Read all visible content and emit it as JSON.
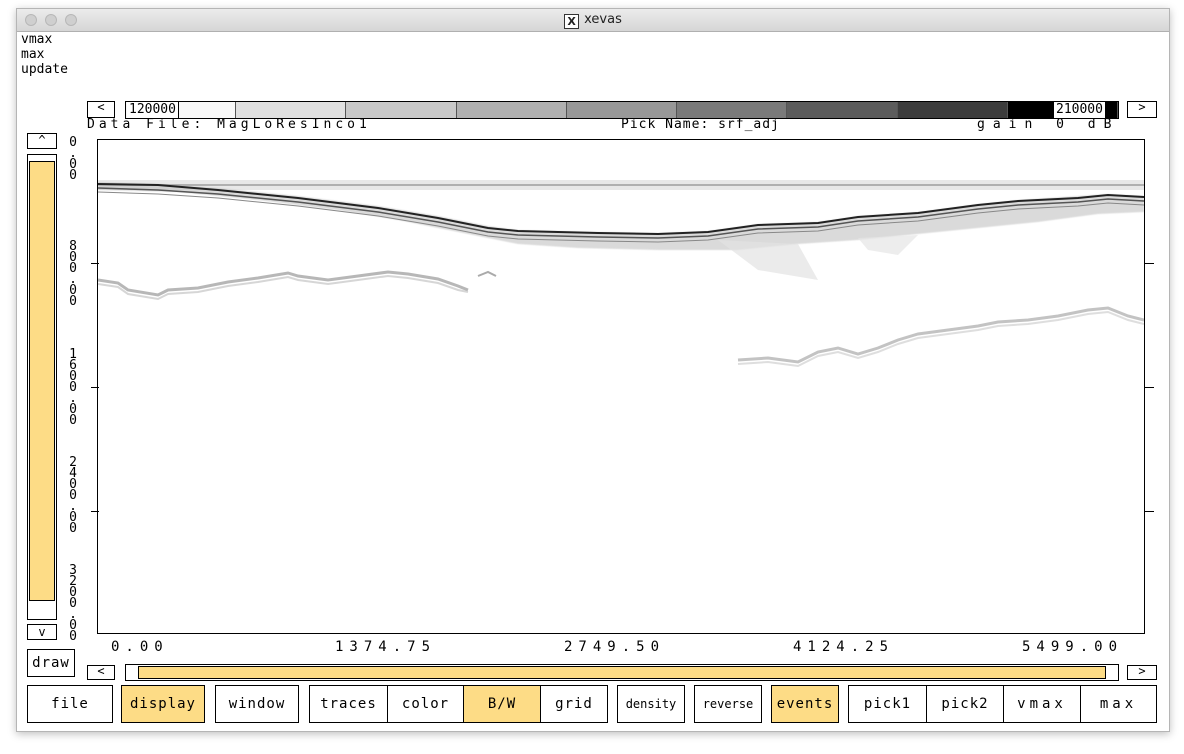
{
  "window": {
    "title": "xevas",
    "title_glyph": "X"
  },
  "messages": [
    "vmax",
    "max",
    "update"
  ],
  "colorbar": {
    "min_label": "120000",
    "max_label": "210000",
    "left_arrow": "<",
    "right_arrow": ">",
    "steps": [
      "#f8f8f8",
      "#e0e0e0",
      "#c8c8c8",
      "#b0b0b0",
      "#989898",
      "#7a7a7a",
      "#5c5c5c",
      "#3c3c3c",
      "#000000"
    ]
  },
  "header": {
    "data_file": "Data File: MagLoResInco1",
    "pick_name": "Pick Name: srf_adj",
    "gain": "gain 0 dB"
  },
  "vscroll": {
    "up": "^",
    "down": "v",
    "draw": "draw",
    "level": 0.96
  },
  "y_axis": {
    "labels": [
      {
        "chars": "0.00"
      },
      {
        "chars": "800.00"
      },
      {
        "chars": "1600.00"
      },
      {
        "chars": "2400.00"
      },
      {
        "chars": "3200.00"
      }
    ]
  },
  "x_axis": {
    "labels": [
      "0.00",
      "1374.75",
      "2749.50",
      "4124.25",
      "5499.00"
    ]
  },
  "hscroll": {
    "left": "<",
    "right": ">",
    "level": 0.98
  },
  "buttons": {
    "file": "file",
    "display": "display",
    "window": "window",
    "traces": "traces",
    "color": "color",
    "bw": "B/W",
    "grid": "grid",
    "density": "density",
    "reverse": "reverse",
    "events": "events",
    "pick1": "pick1",
    "pick2": "pick2",
    "vmax": "vmax",
    "max": "max"
  },
  "colors": {
    "accent": "#fddc86",
    "ink": "#000000"
  }
}
